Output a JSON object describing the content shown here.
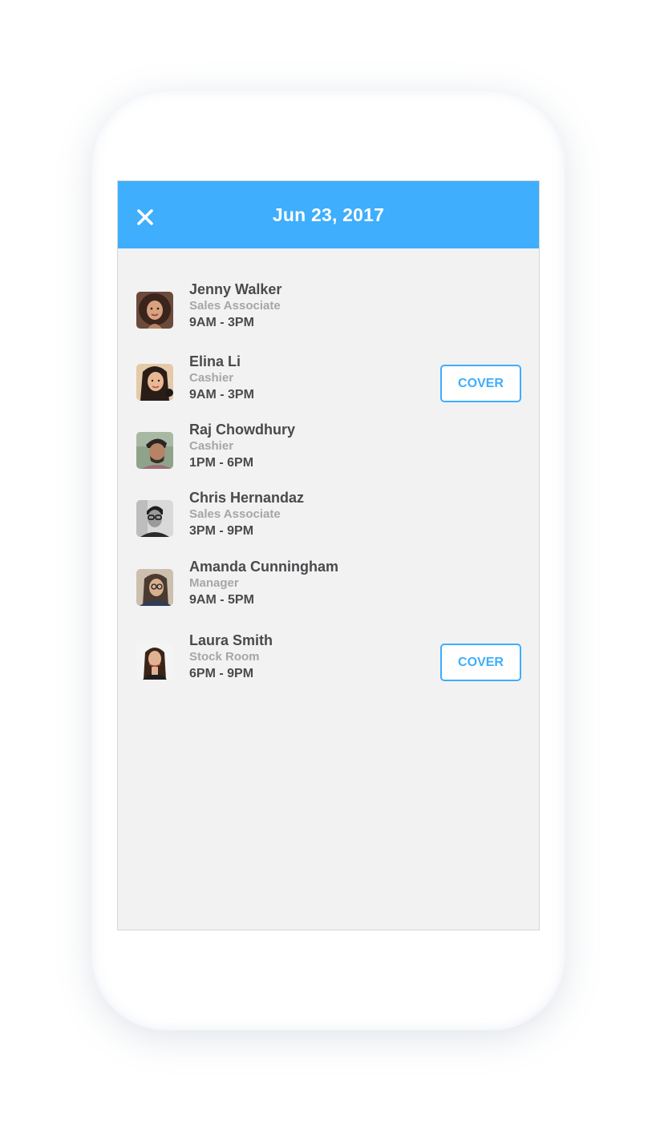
{
  "header": {
    "title": "Jun 23, 2017",
    "close_icon": "close-icon",
    "color": "#3eaefd"
  },
  "employees": [
    {
      "name": "Jenny Walker",
      "role": "Sales Associate",
      "time": "9AM - 3PM",
      "cover": null
    },
    {
      "name": "Elina Li",
      "role": "Cashier",
      "time": "9AM - 3PM",
      "cover": "COVER"
    },
    {
      "name": "Raj Chowdhury",
      "role": "Cashier",
      "time": "1PM - 6PM",
      "cover": null
    },
    {
      "name": "Chris Hernandaz",
      "role": "Sales Associate",
      "time": "3PM - 9PM",
      "cover": null
    },
    {
      "name": "Amanda Cunningham",
      "role": "Manager",
      "time": "9AM - 5PM",
      "cover": null
    },
    {
      "name": "Laura Smith",
      "role": "Stock Room",
      "time": "6PM - 9PM",
      "cover": "COVER"
    }
  ]
}
